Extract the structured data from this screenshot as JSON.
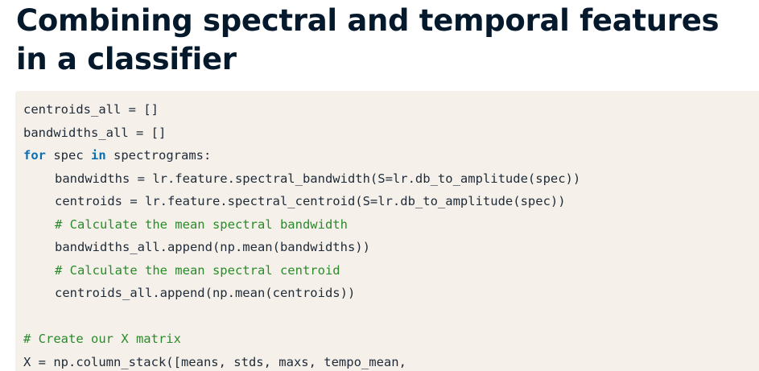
{
  "slide": {
    "title": "Combining spectral and temporal features in a classifier"
  },
  "code": {
    "line1": "centroids_all = []",
    "line2": "bandwidths_all = []",
    "line3": {
      "kw_for": "for",
      "mid": " spec ",
      "kw_in": "in",
      "rest": " spectrograms:"
    },
    "line4": "bandwidths = lr.feature.spectral_bandwidth(S=lr.db_to_amplitude(spec))",
    "line5": "centroids = lr.feature.spectral_centroid(S=lr.db_to_amplitude(spec))",
    "line6": "# Calculate the mean spectral bandwidth",
    "line7": "bandwidths_all.append(np.mean(bandwidths))",
    "line8": "# Calculate the mean spectral centroid",
    "line9": "centroids_all.append(np.mean(centroids))",
    "line10": "",
    "line11": "# Create our X matrix",
    "line12": "X = np.column_stack([means, stds, maxs, tempo_mean,"
  }
}
